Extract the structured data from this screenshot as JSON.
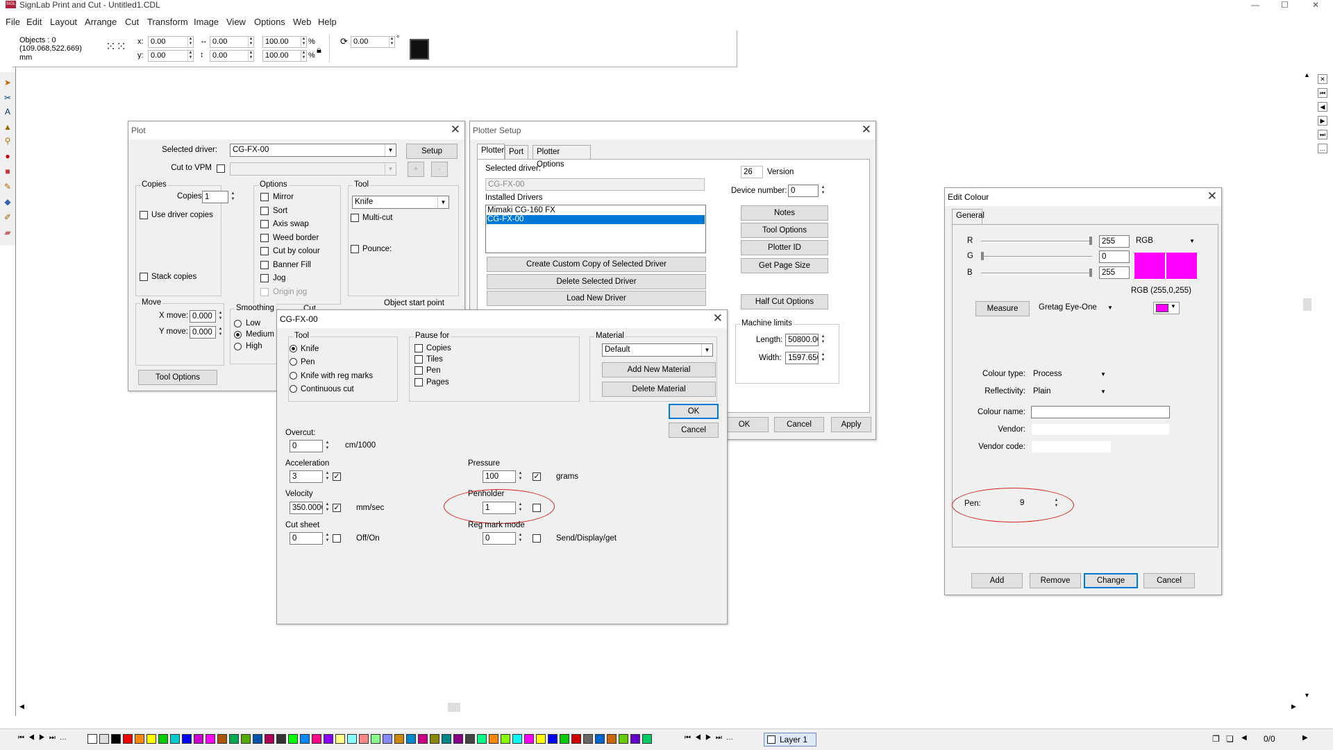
{
  "app": {
    "title": "SignLab Print and Cut - Untitled1.CDL",
    "logo_text": "SIGL",
    "minimize": "—",
    "maximize": "☐",
    "close": "✕"
  },
  "menu": [
    "File",
    "Edit",
    "Layout",
    "Arrange",
    "Cut",
    "Transform",
    "Image",
    "View",
    "Options",
    "Web",
    "Help"
  ],
  "toolbar": {
    "objects": "Objects : 0",
    "coords": "(109.068,522.669)",
    "unit": "mm",
    "x_label": "x:",
    "y_label": "y:",
    "x": "0.00",
    "y": "0.00",
    "w": "0.00",
    "h": "0.00",
    "sx": "100.00",
    "sy": "100.00",
    "pct": "%",
    "rotation": "0.00",
    "deg": "°"
  },
  "plot": {
    "title": "Plot",
    "selected_driver_label": "Selected driver:",
    "selected_driver": "CG-FX-00",
    "setup": "Setup",
    "cut_to_vpm": "Cut to VPM",
    "plus": "+",
    "minus": "-",
    "copies_group": "Copies",
    "copies_label": "Copies:",
    "copies": "1",
    "use_driver_copies": "Use driver copies",
    "stack_copies": "Stack copies",
    "options_group": "Options",
    "options": [
      "Mirror",
      "Sort",
      "Axis swap",
      "Weed border",
      "Cut by colour",
      "Banner Fill",
      "Jog",
      "Origin jog"
    ],
    "tool_group": "Tool",
    "tool": "Knife",
    "multi_cut": "Multi-cut",
    "pounce": "Pounce:",
    "move_group": "Move",
    "x_move_label": "X move:",
    "x_move": "0.000",
    "y_move_label": "Y move:",
    "y_move": "0.000",
    "smoothing_group": "Smoothing",
    "smoothing": [
      "Low",
      "Medium",
      "High"
    ],
    "cut_group": "Cut",
    "object_start_point": "Object start point",
    "tool_options": "Tool Options"
  },
  "plotter_setup": {
    "title": "Plotter Setup",
    "tabs": [
      "Plotter",
      "Port",
      "Plotter Options"
    ],
    "selected_driver_label": "Selected driver:",
    "selected_driver": "CG-FX-00",
    "installed_label": "Installed Drivers",
    "installed": [
      "Mimaki CG-160 FX",
      "CG-FX-00"
    ],
    "create_copy": "Create Custom Copy of Selected Driver",
    "delete_driver": "Delete Selected Driver",
    "load_driver": "Load New Driver",
    "version_num": "26",
    "version_label": "Version",
    "device_number_label": "Device number:",
    "device_number": "0",
    "notes": "Notes",
    "tool_options": "Tool Options",
    "plotter_id": "Plotter ID",
    "get_page_size": "Get Page Size",
    "half_cut": "Half Cut Options",
    "machine_limits": "Machine limits",
    "length_label": "Length:",
    "length": "50800.00",
    "width_label": "Width:",
    "width": "1597.650",
    "ok": "OK",
    "cancel": "Cancel",
    "apply": "Apply"
  },
  "cgfx": {
    "title": "CG-FX-00",
    "tool_group": "Tool",
    "tools": [
      "Knife",
      "Pen",
      "Knife with reg marks",
      "Continuous cut"
    ],
    "pause_group": "Pause for",
    "pause": [
      "Copies",
      "Tiles",
      "Pen",
      "Pages"
    ],
    "material_group": "Material",
    "material": "Default",
    "add_material": "Add New Material",
    "delete_material": "Delete Material",
    "ok": "OK",
    "cancel": "Cancel",
    "overcut_label": "Overcut:",
    "overcut": "0",
    "overcut_unit": "cm/1000",
    "accel_label": "Acceleration",
    "accel": "3",
    "velocity_label": "Velocity",
    "velocity": "350.0000",
    "velocity_unit": "mm/sec",
    "cutsheet_label": "Cut sheet",
    "cutsheet": "0",
    "offon": "Off/On",
    "pressure_label": "Pressure",
    "pressure": "100",
    "pressure_unit": "grams",
    "penholder_label": "Penholder",
    "penholder": "1",
    "regmark_label": "Reg mark mode",
    "regmark": "0",
    "send_display": "Send/Display/get"
  },
  "edit_colour": {
    "title": "Edit Colour",
    "tab": "General",
    "r_label": "R",
    "g_label": "G",
    "b_label": "B",
    "r": "255",
    "g": "0",
    "b": "255",
    "r_frac": 1.0,
    "g_frac": 0.0,
    "b_frac": 1.0,
    "model": "RGB",
    "rgb_text": "RGB  (255,0,255)",
    "measure": "Measure",
    "device": "Gretag Eye-One",
    "colour_type_label": "Colour type:",
    "colour_type": "Process",
    "reflectivity_label": "Reflectivity:",
    "reflectivity": "Plain",
    "colour_name_label": "Colour name:",
    "vendor_label": "Vendor:",
    "vendor_code_label": "Vendor code:",
    "pen_label": "Pen:",
    "pen": "9",
    "add": "Add",
    "remove": "Remove",
    "change": "Change",
    "cancel": "Cancel",
    "swatch_color": "#ff00ff"
  },
  "status": {
    "layer": "Layer 1",
    "page": "0/0",
    "nav": [
      "⏮",
      "◀",
      "▶",
      "⏭",
      "…"
    ]
  },
  "colors": {
    "magenta": "#ff00ff",
    "highlight": "#0078d7",
    "annotation": "#d9211e"
  }
}
